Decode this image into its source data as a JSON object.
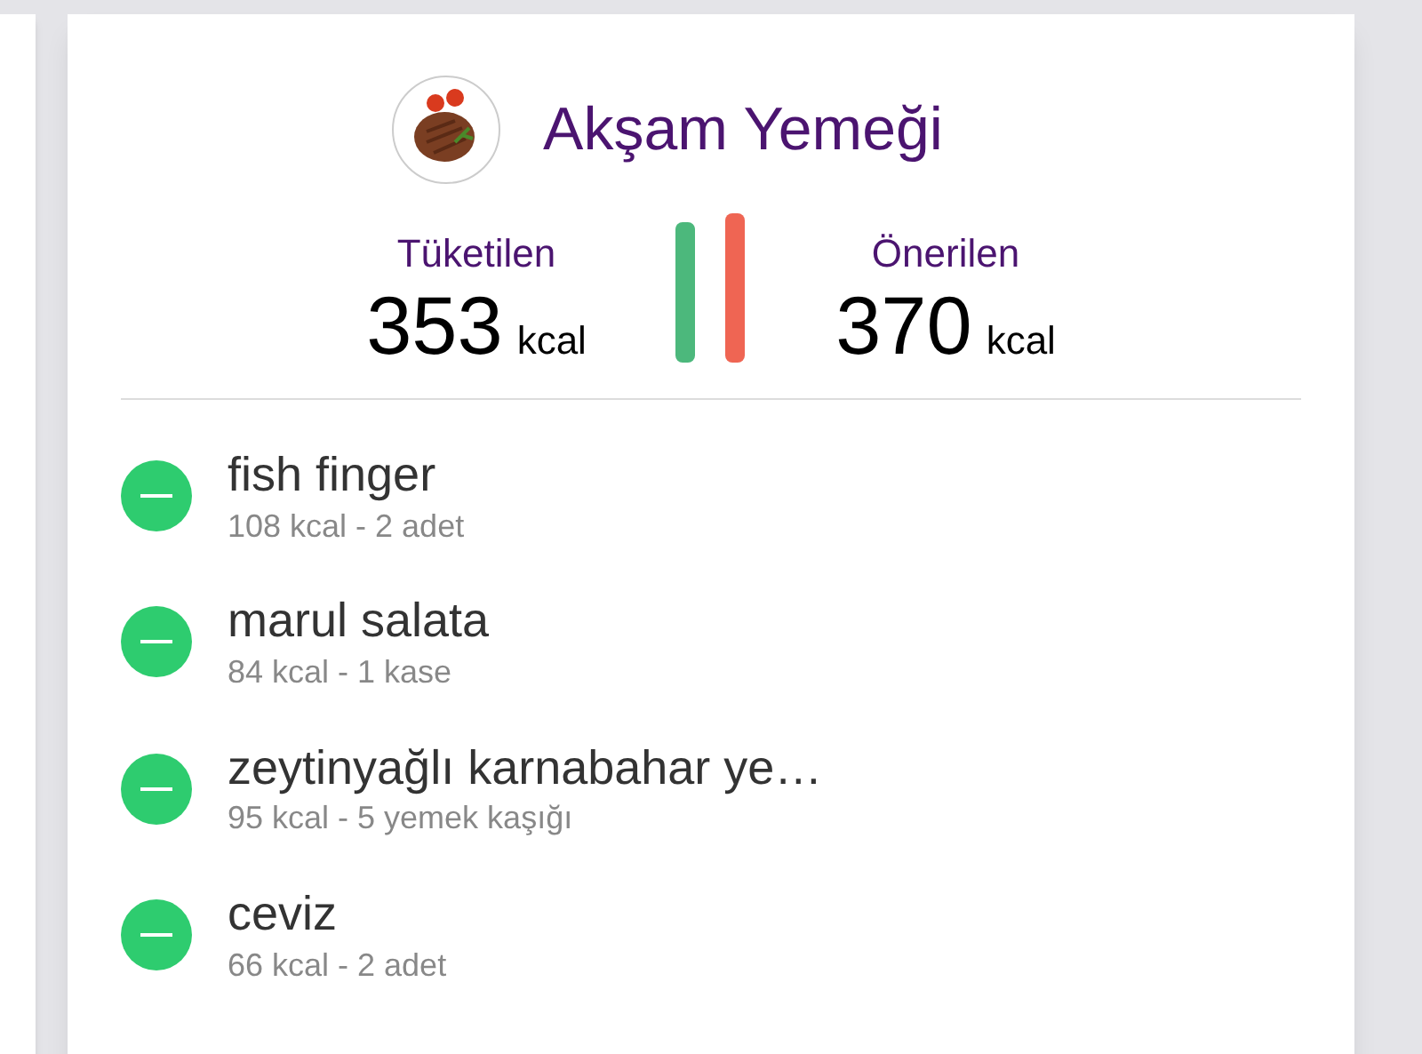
{
  "meal": {
    "title": "Akşam Yemeği"
  },
  "summary": [
    {
      "label": "Tüketilen",
      "value": "353",
      "unit": "kcal"
    },
    {
      "label": "Önerilen",
      "value": "370",
      "unit": "kcal"
    }
  ],
  "items": [
    {
      "name": "fish finger",
      "detail": "108 kcal - 2 adet"
    },
    {
      "name": "marul salata",
      "detail": "84 kcal - 1 kase"
    },
    {
      "name": "zeytinyağlı karnabahar ye…",
      "detail": "95 kcal - 5 yemek kaşığı"
    },
    {
      "name": "ceviz",
      "detail": "66 kcal - 2 adet"
    }
  ]
}
